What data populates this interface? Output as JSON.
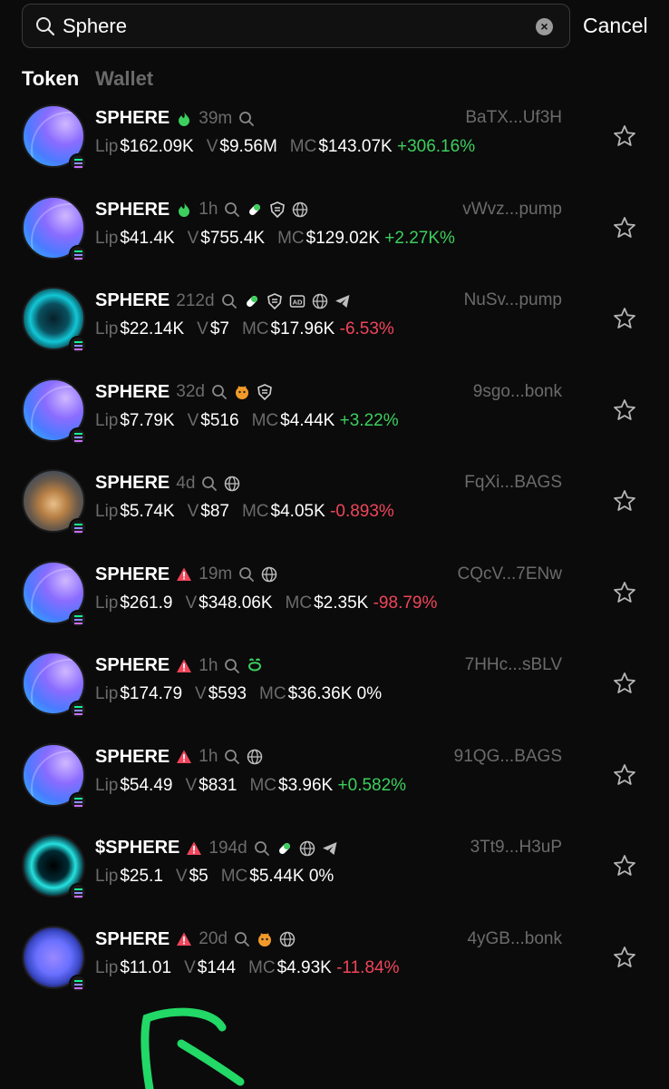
{
  "search": {
    "value": "Sphere",
    "cancel_label": "Cancel"
  },
  "tabs": [
    {
      "label": "Token"
    },
    {
      "label": "Wallet"
    }
  ],
  "labels": {
    "liq": "Lip",
    "vol": "V",
    "mc": "MC"
  },
  "colors": {
    "positive": "#3ccf5e",
    "negative": "#f0455a",
    "muted": "#6b6b6b",
    "background": "#0b0b0b"
  },
  "tokens": [
    {
      "name": "SPHERE",
      "age": "39m",
      "address": "BaTX...Uf3H",
      "liq": "$162.09K",
      "vol": "$9.56M",
      "mc": "$143.07K",
      "change": "+306.16%",
      "trend": "up",
      "avatar": "sphere",
      "badges": [
        "fire-icon",
        "search-icon"
      ]
    },
    {
      "name": "SPHERE",
      "age": "1h",
      "address": "vWvz...pump",
      "liq": "$41.4K",
      "vol": "$755.4K",
      "mc": "$129.02K",
      "change": "+2.27K%",
      "trend": "up",
      "avatar": "sphere",
      "badges": [
        "fire-icon",
        "search-icon",
        "pill-icon",
        "shield-icon",
        "globe-icon"
      ]
    },
    {
      "name": "SPHERE",
      "age": "212d",
      "address": "NuSv...pump",
      "liq": "$22.14K",
      "vol": "$7",
      "mc": "$17.96K",
      "change": "-6.53%",
      "trend": "down",
      "avatar": "teal",
      "badges": [
        "search-icon",
        "pill-icon",
        "shield-icon",
        "ad-icon",
        "globe-icon",
        "telegram-icon"
      ]
    },
    {
      "name": "SPHERE",
      "age": "32d",
      "address": "9sgo...bonk",
      "liq": "$7.79K",
      "vol": "$516",
      "mc": "$4.44K",
      "change": "+3.22%",
      "trend": "up",
      "avatar": "sphere",
      "badges": [
        "search-icon",
        "bonk-icon",
        "shield-icon"
      ]
    },
    {
      "name": "SPHERE",
      "age": "4d",
      "address": "FqXi...BAGS",
      "liq": "$5.74K",
      "vol": "$87",
      "mc": "$4.05K",
      "change": "-0.893%",
      "trend": "down",
      "avatar": "bread",
      "badges": [
        "search-icon",
        "globe-icon"
      ]
    },
    {
      "name": "SPHERE",
      "age": "19m",
      "address": "CQcV...7ENw",
      "liq": "$261.9",
      "vol": "$348.06K",
      "mc": "$2.35K",
      "change": "-98.79%",
      "trend": "down",
      "avatar": "sphere",
      "badges": [
        "warning-icon",
        "search-icon",
        "globe-icon"
      ]
    },
    {
      "name": "SPHERE",
      "age": "1h",
      "address": "7HHc...sBLV",
      "liq": "$174.79",
      "vol": "$593",
      "mc": "$36.36K",
      "change": "0%",
      "trend": "flat",
      "avatar": "sphere",
      "badges": [
        "warning-icon",
        "search-icon",
        "green-logo-icon"
      ]
    },
    {
      "name": "SPHERE",
      "age": "1h",
      "address": "91QG...BAGS",
      "liq": "$54.49",
      "vol": "$831",
      "mc": "$3.96K",
      "change": "+0.582%",
      "trend": "up",
      "avatar": "sphere",
      "badges": [
        "warning-icon",
        "search-icon",
        "globe-icon"
      ]
    },
    {
      "name": "$SPHERE",
      "age": "194d",
      "address": "3Tt9...H3uP",
      "liq": "$25.1",
      "vol": "$5",
      "mc": "$5.44K",
      "change": "0%",
      "trend": "flat",
      "avatar": "teal2",
      "badges": [
        "warning-icon",
        "search-icon",
        "pill-icon",
        "globe-icon",
        "telegram-icon"
      ]
    },
    {
      "name": "SPHERE",
      "age": "20d",
      "address": "4yGB...bonk",
      "liq": "$11.01",
      "vol": "$144",
      "mc": "$4.93K",
      "change": "-11.84%",
      "trend": "down",
      "avatar": "sphere-dark",
      "badges": [
        "warning-icon",
        "search-icon",
        "bonk-icon",
        "globe-icon"
      ]
    }
  ]
}
